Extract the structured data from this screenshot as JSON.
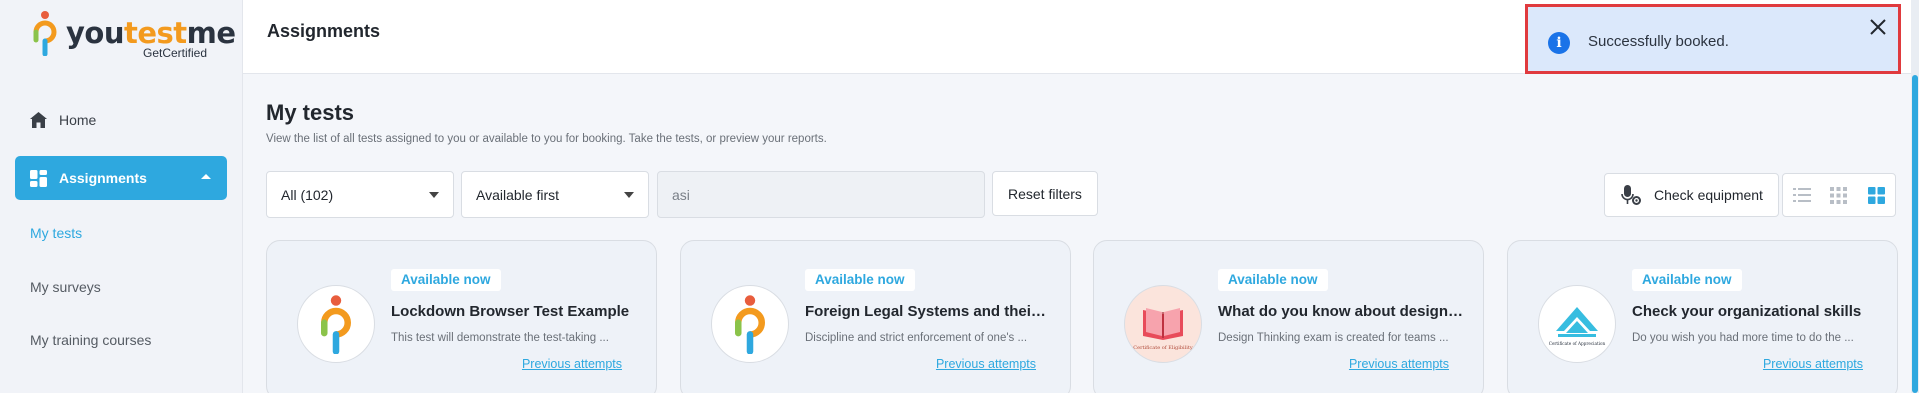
{
  "brand": {
    "name_part1": "you",
    "name_part2": "test",
    "name_part3": "me",
    "tagline": "GetCertified"
  },
  "sidebar": {
    "items": [
      {
        "label": "Home",
        "icon": "home-icon"
      },
      {
        "label": "Assignments",
        "icon": "dashboard-icon",
        "expanded": true
      }
    ],
    "sub_items": [
      {
        "label": "My tests",
        "active": true
      },
      {
        "label": "My surveys"
      },
      {
        "label": "My training courses"
      }
    ]
  },
  "header": {
    "title": "Assignments"
  },
  "toast": {
    "message": "Successfully booked.",
    "icon": "info-icon",
    "background": "#dbe8fb",
    "border": "#e03a3e"
  },
  "main": {
    "title": "My tests",
    "description": "View the list of all tests assigned to you or available to you for booking. Take the tests, or preview your reports.",
    "filters": {
      "scope_value": "All (102)",
      "sort_value": "Available first",
      "search_value": "asi",
      "reset_label": "Reset filters"
    },
    "check_equipment_label": "Check equipment",
    "view_modes": [
      "list-view-icon",
      "compact-grid-icon",
      "grid-view-icon"
    ]
  },
  "cards": [
    {
      "badge": "Available now",
      "title": "Lockdown Browser Test Example",
      "description": "This test will demonstrate the test-taking ...",
      "link": "Previous attempts",
      "thumb": "youtestme-logo"
    },
    {
      "badge": "Available now",
      "title": "Foreign Legal Systems and their ...",
      "description": "Discipline and strict enforcement of one's ...",
      "link": "Previous attempts",
      "thumb": "youtestme-logo"
    },
    {
      "badge": "Available now",
      "title": "What do you know about design t...",
      "description": "Design Thinking exam is created for teams ...",
      "link": "Previous attempts",
      "thumb": "book-certificate",
      "thumb_caption": "Certificate of Eligibility"
    },
    {
      "badge": "Available now",
      "title": "Check your organizational skills",
      "description": "Do you wish you had more time to do the ...",
      "link": "Previous attempts",
      "thumb": "appreciation-certificate",
      "thumb_caption": "Certificate of Appreciation"
    }
  ],
  "colors": {
    "accent": "#2ea8df",
    "brand_orange": "#f39a1e"
  }
}
